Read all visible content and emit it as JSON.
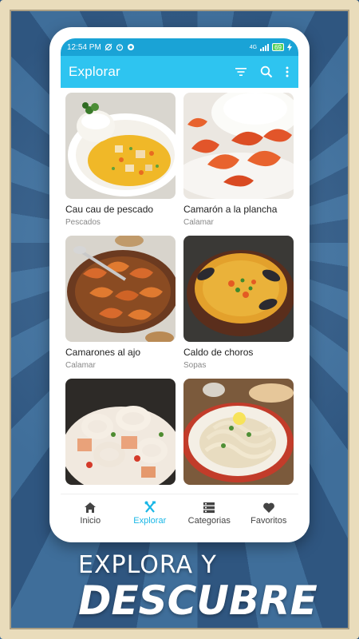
{
  "status_bar": {
    "time": "12:54 PM",
    "battery": "69",
    "network": "4G"
  },
  "app_bar": {
    "title": "Explorar",
    "icons": [
      "filter-icon",
      "search-icon",
      "more-vert-icon"
    ]
  },
  "recipes": [
    {
      "title": "Cau cau de pescado",
      "category": "Pescados"
    },
    {
      "title": "Camarón a la plancha",
      "category": "Calamar"
    },
    {
      "title": "Camarones al ajo",
      "category": "Calamar"
    },
    {
      "title": "Caldo de choros",
      "category": "Sopas"
    },
    {
      "title": "",
      "category": ""
    },
    {
      "title": "",
      "category": ""
    }
  ],
  "bottom_nav": [
    {
      "label": "Inicio",
      "icon": "home-icon",
      "active": false
    },
    {
      "label": "Explorar",
      "icon": "utensils-icon",
      "active": true
    },
    {
      "label": "Categorias",
      "icon": "list-icon",
      "active": false
    },
    {
      "label": "Favoritos",
      "icon": "heart-icon",
      "active": false
    }
  ],
  "promo": {
    "line1": "EXPLORA Y",
    "line2": "DESCUBRE"
  },
  "colors": {
    "status_bar": "#1aa3d6",
    "app_bar": "#2ec4f0",
    "accent": "#1ab7e6",
    "background_blue": "#2f5680"
  }
}
